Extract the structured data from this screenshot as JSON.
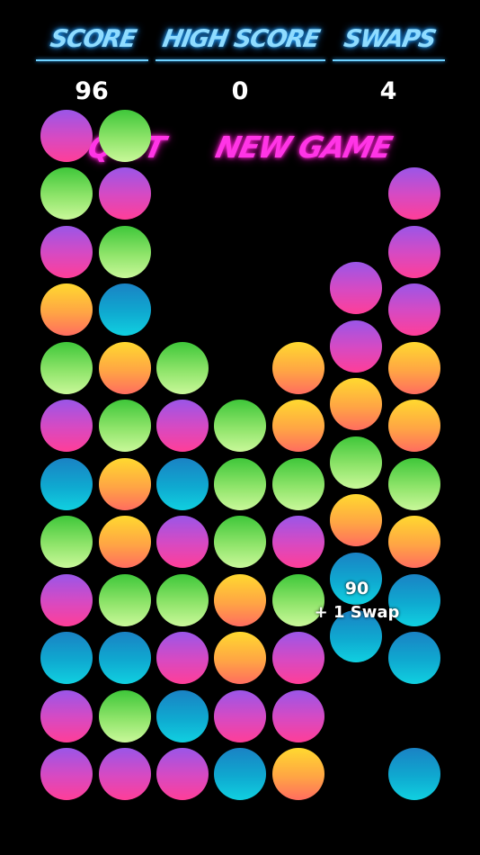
{
  "header": {
    "score_label": "SCORE",
    "high_score_label": "HIGH SCORE",
    "swaps_label": "SWAPS",
    "score_value": "96",
    "high_score_value": "0",
    "swaps_value": "4"
  },
  "menu": {
    "quit_label": "QUIT",
    "new_game_label": "NEW GAME"
  },
  "popup": {
    "points": "90",
    "bonus": "+ 1 Swap"
  },
  "colors": {
    "magenta": "#d64ac3",
    "green": "#8fe46a",
    "orange": "#ffa544",
    "blue": "#0fa9d0",
    "header_text": "#8fdcff",
    "menu_text": "#ff35e6"
  },
  "board": {
    "columns": 7,
    "rows": 10,
    "grid_bottom_to_top": [
      [
        "magenta",
        "magenta",
        "blue",
        "magenta",
        "green",
        "blue",
        "magenta",
        "green",
        "orange",
        "magenta",
        "green",
        "magenta"
      ],
      [
        "magenta",
        "green",
        "blue",
        "green",
        "orange",
        "orange",
        "green",
        "orange",
        "blue",
        "green",
        "magenta",
        "green"
      ],
      [
        "magenta",
        "blue",
        "magenta",
        "green",
        "magenta",
        "blue",
        "magenta",
        "green"
      ],
      [
        "blue",
        "magenta",
        "orange",
        "orange",
        "green",
        "green",
        "green"
      ],
      [
        "orange",
        "magenta",
        "magenta",
        "green",
        "magenta",
        "green",
        "orange",
        "orange"
      ],
      [
        "blue",
        "blue",
        "orange",
        "green",
        "orange",
        "magenta",
        "magenta"
      ],
      [
        "blue",
        null,
        "blue",
        "blue",
        "orange",
        "green",
        "orange",
        "orange",
        "magenta",
        "magenta",
        "magenta"
      ]
    ]
  }
}
